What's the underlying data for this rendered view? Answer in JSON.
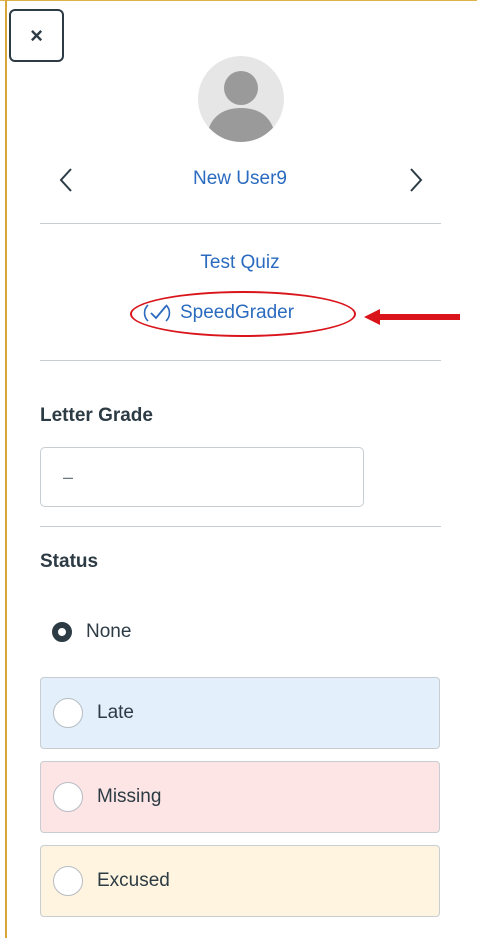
{
  "header": {
    "close_label": "×"
  },
  "student": {
    "name": "New User9",
    "prev_label": "previous student",
    "next_label": "next student"
  },
  "assignment": {
    "title": "Test Quiz",
    "speedgrader_label": "SpeedGrader"
  },
  "grade": {
    "label": "Letter Grade",
    "value": "–"
  },
  "status": {
    "label": "Status",
    "options": [
      {
        "label": "None",
        "selected": true
      },
      {
        "label": "Late",
        "color": "#e3f0fb",
        "border": "#c7cdd1"
      },
      {
        "label": "Missing",
        "color": "#fde5e5",
        "border": "#c7cdd1"
      },
      {
        "label": "Excused",
        "color": "#fef4df",
        "border": "#c7cdd1"
      }
    ]
  },
  "annotation": {
    "color": "#d9141b"
  },
  "colors": {
    "link": "#2b6bbf",
    "text": "#2d3b45",
    "divider": "#c7cdd1"
  }
}
